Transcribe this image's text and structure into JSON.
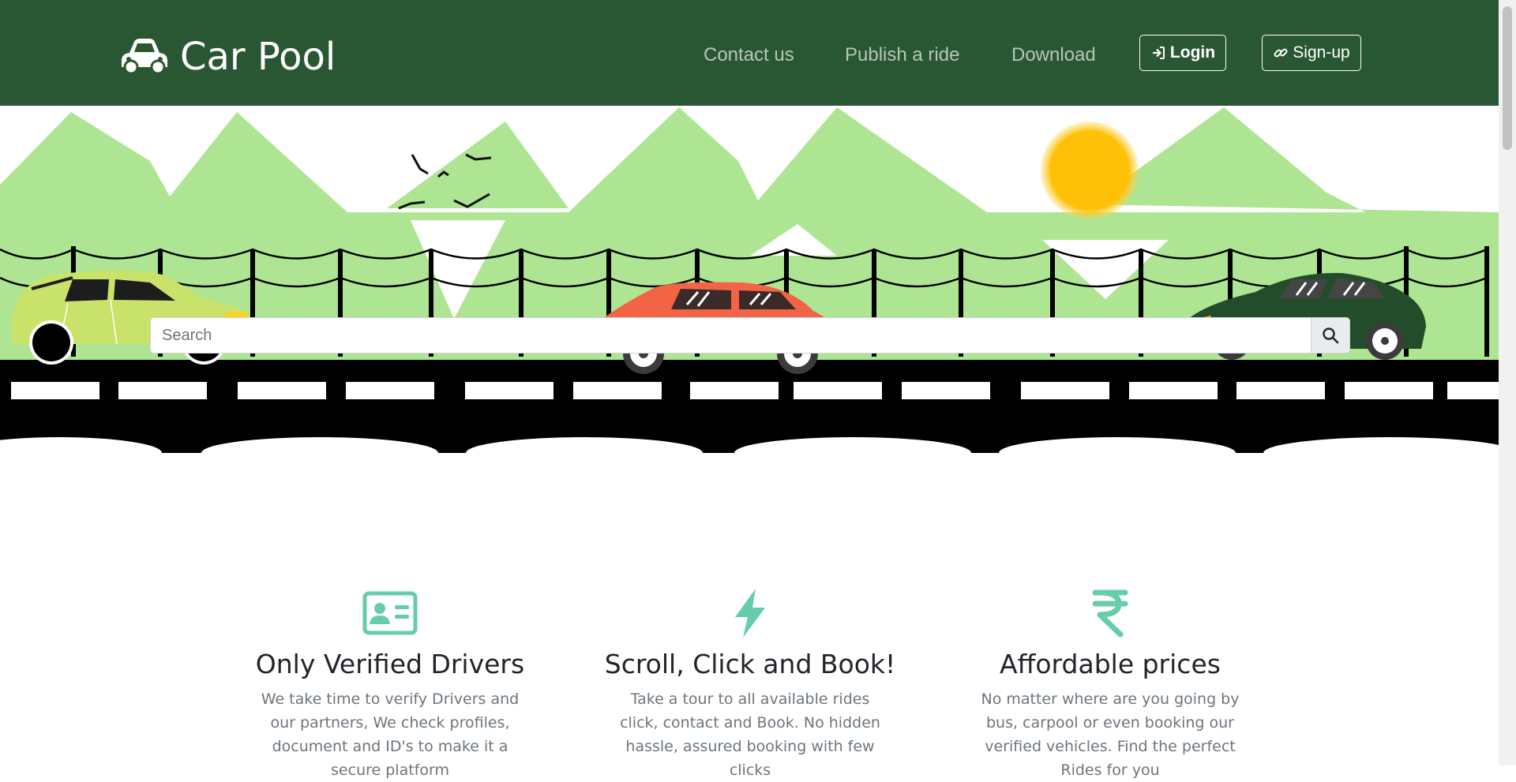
{
  "brand": {
    "name": "Car Pool",
    "icon": "car-icon"
  },
  "nav": {
    "links": [
      "Contact us",
      "Publish a ride",
      "Download"
    ],
    "login_label": "Login",
    "signup_label": "Sign-up"
  },
  "search": {
    "placeholder": "Search",
    "value": ""
  },
  "features": [
    {
      "icon": "id-card-icon",
      "title": "Only Verified Drivers",
      "text": "We take time to verify Drivers and our partners, We check profiles, document and ID's to make it a secure platform"
    },
    {
      "icon": "lightning-icon",
      "title": "Scroll, Click and Book!",
      "text": "Take a tour to all available rides click, contact and Book. No hidden hassle, assured booking with few clicks"
    },
    {
      "icon": "rupee-icon",
      "title": "Affordable prices",
      "text": "No matter where are you going by bus, carpool or even booking our verified vehicles. Find the perfect Rides for you"
    }
  ],
  "colors": {
    "navbar": "#2a5733",
    "accent": "#66cdaa",
    "hills": "#aee593",
    "sun": "#ffc107"
  }
}
